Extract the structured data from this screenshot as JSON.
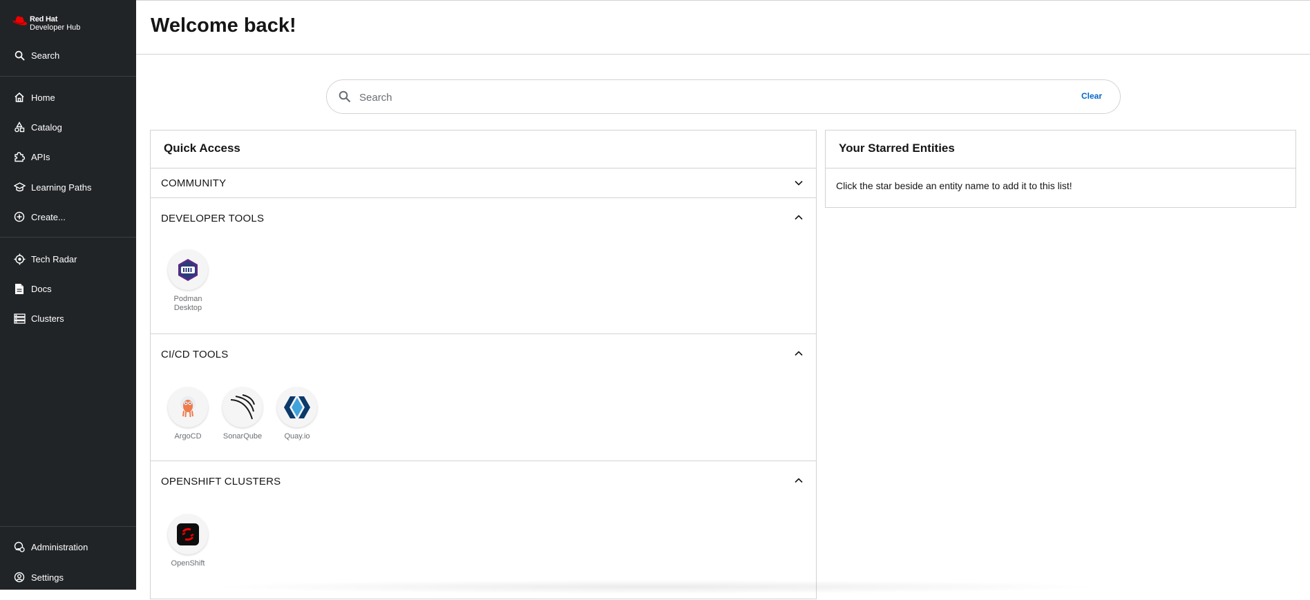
{
  "brand": {
    "line1": "Red Hat",
    "line2": "Developer Hub"
  },
  "sidebar": {
    "search_label": "Search",
    "items": [
      {
        "label": "Home",
        "icon": "home-icon"
      },
      {
        "label": "Catalog",
        "icon": "catalog-icon"
      },
      {
        "label": "APIs",
        "icon": "puzzle-icon"
      },
      {
        "label": "Learning Paths",
        "icon": "school-icon"
      },
      {
        "label": "Create...",
        "icon": "add-circle-icon"
      },
      {
        "label": "Tech Radar",
        "icon": "radar-icon"
      },
      {
        "label": "Docs",
        "icon": "document-icon"
      },
      {
        "label": "Clusters",
        "icon": "clusters-icon"
      }
    ],
    "bottom": [
      {
        "label": "Administration",
        "icon": "admin-icon"
      },
      {
        "label": "Settings",
        "icon": "account-icon"
      }
    ]
  },
  "header": {
    "title": "Welcome back!"
  },
  "search": {
    "placeholder": "Search",
    "clear_label": "Clear"
  },
  "quick_access": {
    "title": "Quick Access",
    "sections": [
      {
        "title": "COMMUNITY",
        "expanded": false,
        "items": []
      },
      {
        "title": "DEVELOPER TOOLS",
        "expanded": true,
        "items": [
          {
            "label": "Podman Desktop",
            "icon": "podman-icon"
          }
        ]
      },
      {
        "title": "CI/CD TOOLS",
        "expanded": true,
        "items": [
          {
            "label": "ArgoCD",
            "icon": "argocd-icon"
          },
          {
            "label": "SonarQube",
            "icon": "sonarqube-icon"
          },
          {
            "label": "Quay.io",
            "icon": "quay-icon"
          }
        ]
      },
      {
        "title": "OPENSHIFT CLUSTERS",
        "expanded": true,
        "items": [
          {
            "label": "OpenShift",
            "icon": "openshift-icon"
          }
        ]
      }
    ]
  },
  "starred": {
    "title": "Your Starred Entities",
    "empty_text": "Click the star beside an entity name to add it to this list!"
  },
  "colors": {
    "sidebar_bg": "#212427",
    "accent": "#0066cc",
    "brand_red": "#ee0000"
  }
}
